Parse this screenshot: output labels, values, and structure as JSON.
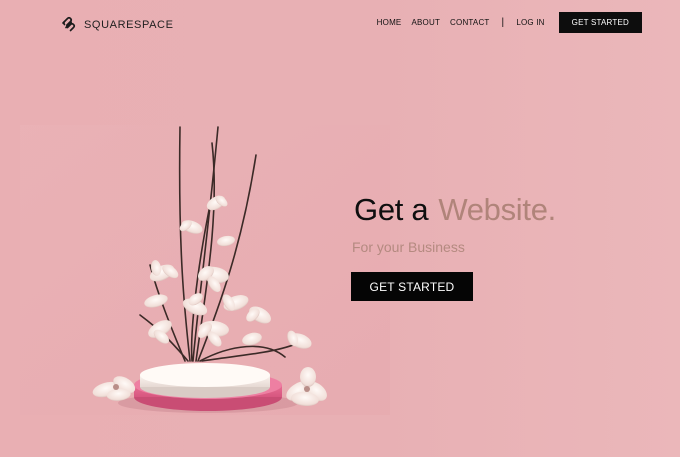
{
  "brand": {
    "name": "SQUARESPACE",
    "logo_icon": "squarespace-logo-icon"
  },
  "nav": {
    "items": [
      {
        "label": "HOME"
      },
      {
        "label": "ABOUT"
      },
      {
        "label": "CONTACT"
      }
    ],
    "separator": "|",
    "login_label": "LOG IN",
    "cta_label": "GET STARTED"
  },
  "hero": {
    "headline_part1": "Get a",
    "headline_part2": "Website.",
    "subheadline": "For your Business",
    "cta_label": "GET STARTED"
  },
  "colors": {
    "background": "#e8aeb2",
    "accent_text": "#b0847a",
    "button_bg": "#050505",
    "button_text": "#ffffff"
  }
}
